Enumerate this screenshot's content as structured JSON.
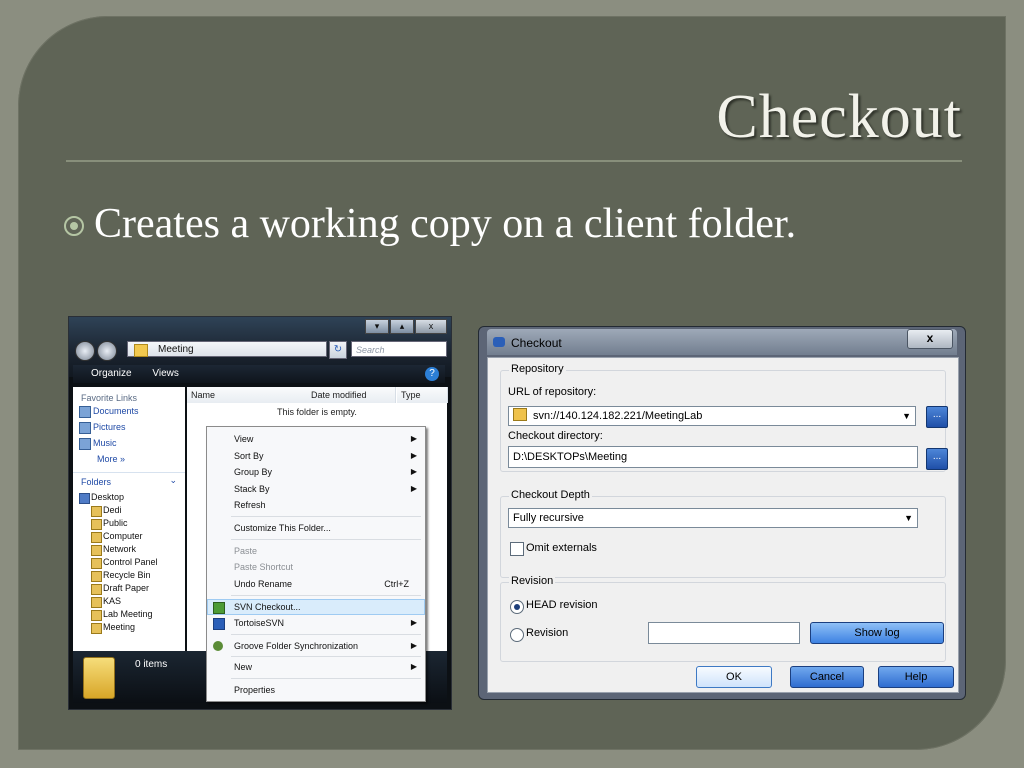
{
  "slide": {
    "title": "Checkout",
    "bullet": "Creates a working copy on a client folder."
  },
  "explorer": {
    "address": "Meeting",
    "search_placeholder": "Search",
    "toolbar": {
      "organize": "Organize",
      "views": "Views",
      "help_icon": "?"
    },
    "window_buttons": [
      "▾",
      "▴",
      "x"
    ],
    "favorite_links_label": "Favorite Links",
    "favorite_links": [
      "Documents",
      "Pictures",
      "Music"
    ],
    "more_label": "More",
    "folders_label": "Folders",
    "tree": [
      "Desktop",
      "Dedi",
      "Public",
      "Computer",
      "Network",
      "Control Panel",
      "Recycle Bin",
      "Draft Paper",
      "KAS",
      "Lab Meeting",
      "Meeting"
    ],
    "columns": [
      "Name",
      "Date modified",
      "Type"
    ],
    "empty_message": "This folder is empty.",
    "status": "0 items"
  },
  "context_menu": {
    "items": [
      {
        "label": "View",
        "submenu": true
      },
      {
        "label": "Sort By",
        "submenu": true
      },
      {
        "label": "Group By",
        "submenu": true
      },
      {
        "label": "Stack By",
        "submenu": true
      },
      {
        "label": "Refresh"
      },
      {
        "label": "Customize This Folder..."
      },
      {
        "label": "Paste",
        "disabled": true
      },
      {
        "label": "Paste Shortcut",
        "disabled": true
      },
      {
        "label": "Undo Rename",
        "shortcut": "Ctrl+Z"
      },
      {
        "label": "SVN Checkout...",
        "highlighted": true,
        "icon": "svn-checkout-icon"
      },
      {
        "label": "TortoiseSVN",
        "submenu": true,
        "icon": "tortoisesvn-icon"
      },
      {
        "label": "Groove Folder Synchronization",
        "submenu": true,
        "icon": "groove-icon"
      },
      {
        "label": "New",
        "submenu": true
      },
      {
        "label": "Properties"
      }
    ]
  },
  "checkout_dialog": {
    "title": "Checkout",
    "close_label": "x",
    "repository_group": "Repository",
    "url_label": "URL of repository:",
    "url_value": "svn://140.124.182.221/MeetingLab",
    "directory_label": "Checkout directory:",
    "directory_value": "D:\\DESKTOPs\\Meeting",
    "browse_label": "...",
    "depth_group": "Checkout Depth",
    "depth_value": "Fully recursive",
    "omit_externals_label": "Omit externals",
    "revision_group": "Revision",
    "head_revision_label": "HEAD revision",
    "revision_label": "Revision",
    "revision_value": "",
    "show_log_label": "Show log",
    "ok_label": "OK",
    "cancel_label": "Cancel",
    "help_label": "Help"
  }
}
